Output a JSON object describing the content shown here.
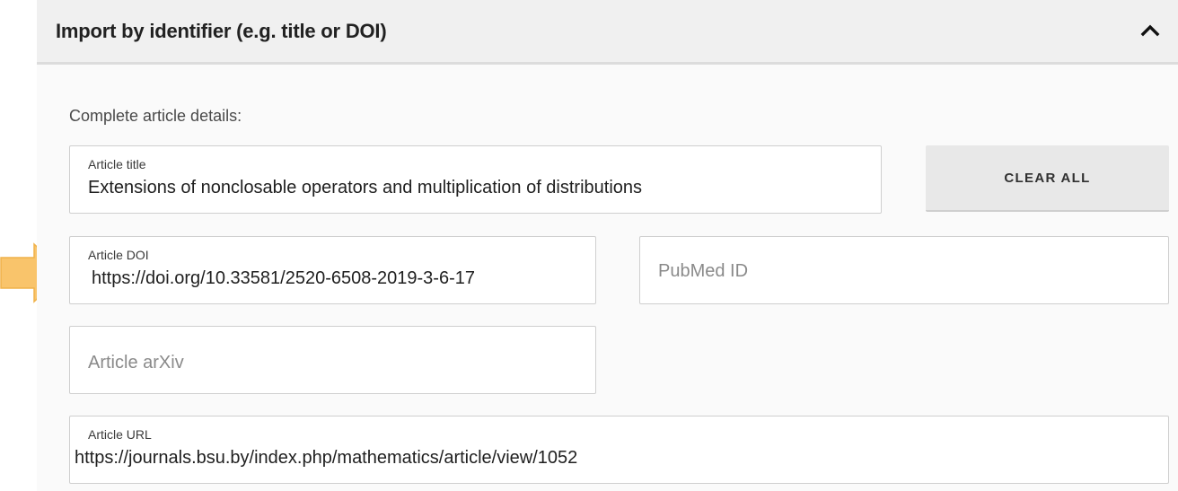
{
  "panel": {
    "title": "Import by identifier (e.g. title or DOI)",
    "collapse_icon": "chevron-up-icon",
    "hint": "Complete article details:"
  },
  "fields": {
    "title": {
      "label": "Article title",
      "value": "Extensions of nonclosable operators and multiplication of distributions"
    },
    "doi": {
      "label": "Article DOI",
      "value": "https://doi.org/10.33581/2520-6508-2019-3-6-17"
    },
    "pubmed": {
      "placeholder": "PubMed ID"
    },
    "arxiv": {
      "placeholder": "Article arXiv"
    },
    "url": {
      "label": "Article URL",
      "value": "https://journals.bsu.by/index.php/mathematics/article/view/1052"
    }
  },
  "actions": {
    "clear_all_label": "CLEAR ALL"
  },
  "annotation": {
    "icon": "arrow-right-icon",
    "color": "#f9c46b"
  }
}
